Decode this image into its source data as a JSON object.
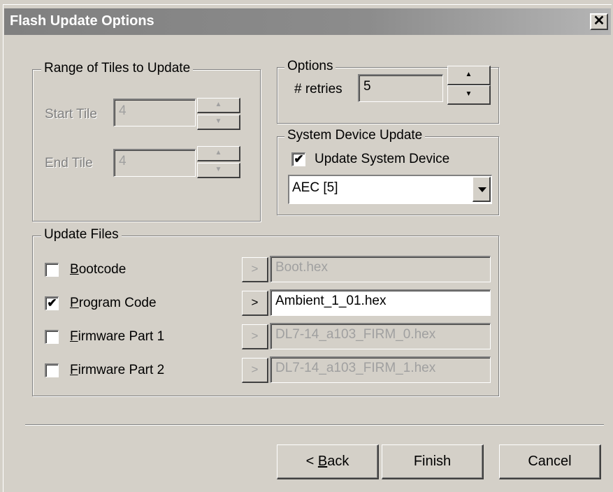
{
  "dialog": {
    "title": "Flash Update Options",
    "close_glyph": "✕"
  },
  "range_group": {
    "legend": "Range of Tiles to Update",
    "start_label": "Start Tile",
    "start_value": "4",
    "end_label": "End Tile",
    "end_value": "4",
    "enabled": false
  },
  "options_group": {
    "legend": "Options",
    "retries_label": "# retries",
    "retries_value": "5"
  },
  "system_group": {
    "legend": "System Device Update",
    "checkbox_label": "Update System Device",
    "checked": true,
    "device_value": "AEC [5]"
  },
  "files_group": {
    "legend": "Update Files",
    "rows": [
      {
        "label": "Bootcode",
        "mnemonic_first": "B",
        "rest": "ootcode",
        "checked": false,
        "file": "Boot.hex",
        "enabled": false
      },
      {
        "label": "Program Code",
        "mnemonic_first": "P",
        "rest": "rogram Code",
        "checked": true,
        "file": "Ambient_1_01.hex",
        "enabled": true
      },
      {
        "label": "Firmware Part 1",
        "mnemonic_first": "F",
        "rest": "irmware Part 1",
        "checked": false,
        "file": "DL7-14_a103_FIRM_0.hex",
        "enabled": false
      },
      {
        "label": "Firmware Part 2",
        "mnemonic_first": "F",
        "rest": "irmware Part 2",
        "checked": false,
        "file": "DL7-14_a103_FIRM_1.hex",
        "enabled": false
      }
    ],
    "browse_glyph": ">"
  },
  "buttons": {
    "back_prefix": "< ",
    "back_mnemonic": "B",
    "back_rest": "ack",
    "finish": "Finish",
    "cancel": "Cancel"
  },
  "icons": {
    "check": "✔",
    "spin_up": "▲",
    "spin_down": "▼"
  }
}
